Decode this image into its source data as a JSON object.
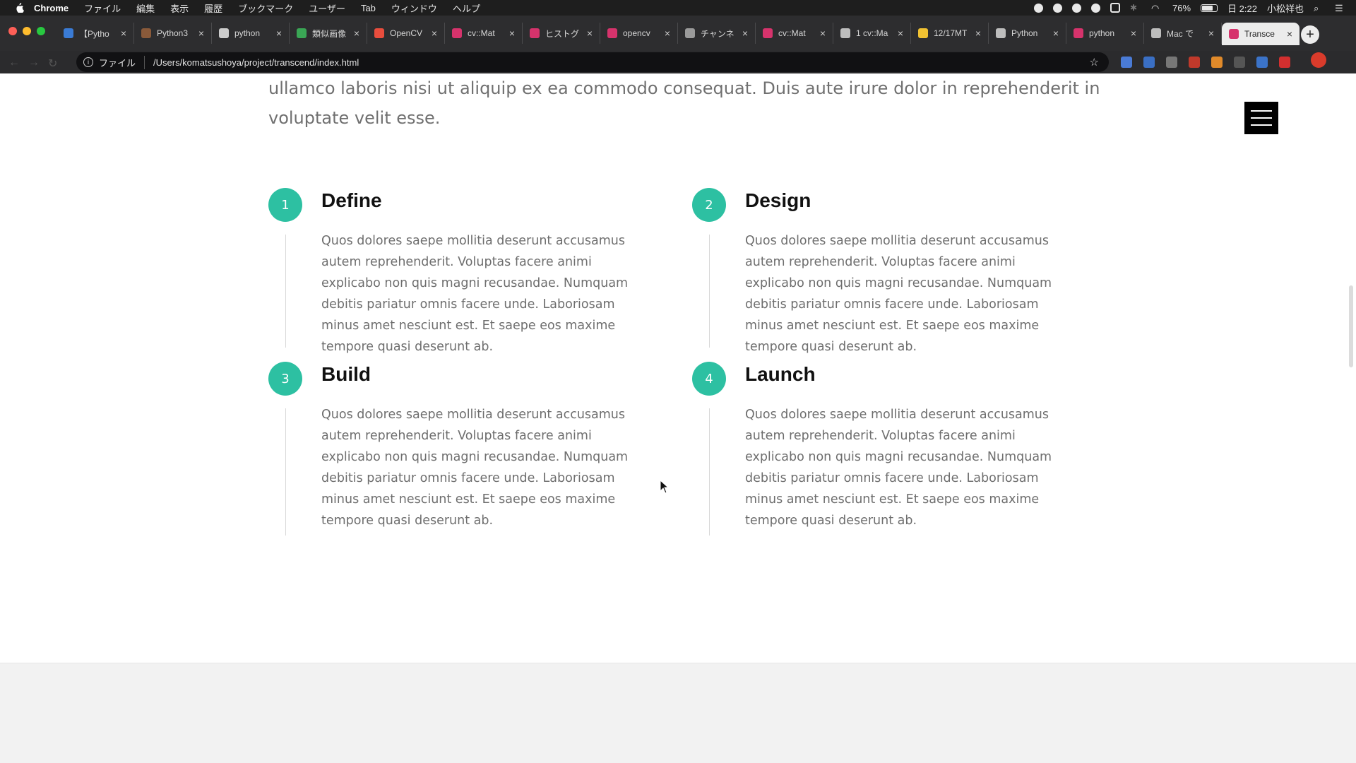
{
  "menubar": {
    "app": "Chrome",
    "items": [
      "ファイル",
      "編集",
      "表示",
      "履歴",
      "ブックマーク",
      "ユーザー",
      "Tab",
      "ウィンドウ",
      "ヘルプ"
    ],
    "battery": "76%",
    "clock": "日 2:22",
    "user": "小松祥也"
  },
  "tabs": [
    {
      "title": "【Pytho",
      "color": "#3a7bd5"
    },
    {
      "title": "Python3",
      "color": "#8a5a3a"
    },
    {
      "title": "python",
      "color": "#cccccc"
    },
    {
      "title": "類似画像",
      "color": "#3aa655"
    },
    {
      "title": "OpenCV",
      "color": "#e84d3d"
    },
    {
      "title": "cv::Mat",
      "color": "#d6336c"
    },
    {
      "title": "ヒストグ",
      "color": "#d6336c"
    },
    {
      "title": "opencv",
      "color": "#d6336c"
    },
    {
      "title": "チャンネ",
      "color": "#9a9a9a"
    },
    {
      "title": "cv::Mat",
      "color": "#d6336c"
    },
    {
      "title": "1 cv::Ma",
      "color": "#bdbdbd"
    },
    {
      "title": "12/17MT",
      "color": "#f1c232"
    },
    {
      "title": "Python",
      "color": "#bdbdbd"
    },
    {
      "title": "python",
      "color": "#d6336c"
    },
    {
      "title": "Mac で",
      "color": "#bdbdbd"
    },
    {
      "title": "Transce",
      "color": "#d6336c",
      "active": true
    }
  ],
  "omnibox": {
    "scheme": "ファイル",
    "url": "/Users/komatsushoya/project/transcend/index.html"
  },
  "page": {
    "intro_line1": "ullamco laboris nisi ut aliquip ex ea commodo consequat. Duis aute irure dolor in reprehenderit in",
    "intro_line2": "voluptate velit esse.",
    "steps": [
      {
        "number": "1",
        "title": "Define",
        "text": "Quos dolores saepe mollitia deserunt accusamus autem reprehenderit. Voluptas facere animi explicabo non quis magni recusandae. Numquam debitis pariatur omnis facere unde. Laboriosam minus amet nesciunt est. Et saepe eos maxime tempore quasi deserunt ab."
      },
      {
        "number": "2",
        "title": "Design",
        "text": "Quos dolores saepe mollitia deserunt accusamus autem reprehenderit. Voluptas facere animi explicabo non quis magni recusandae. Numquam debitis pariatur omnis facere unde. Laboriosam minus amet nesciunt est. Et saepe eos maxime tempore quasi deserunt ab."
      },
      {
        "number": "3",
        "title": "Build",
        "text": "Quos dolores saepe mollitia deserunt accusamus autem reprehenderit. Voluptas facere animi explicabo non quis magni recusandae. Numquam debitis pariatur omnis facere unde. Laboriosam minus amet nesciunt est. Et saepe eos maxime tempore quasi deserunt ab."
      },
      {
        "number": "4",
        "title": "Launch",
        "text": "Quos dolores saepe mollitia deserunt accusamus autem reprehenderit. Voluptas facere animi explicabo non quis magni recusandae. Numquam debitis pariatur omnis facere unde. Laboriosam minus amet nesciunt est. Et saepe eos maxime tempore quasi deserunt ab."
      }
    ],
    "accent_color": "#2dc0a2"
  }
}
